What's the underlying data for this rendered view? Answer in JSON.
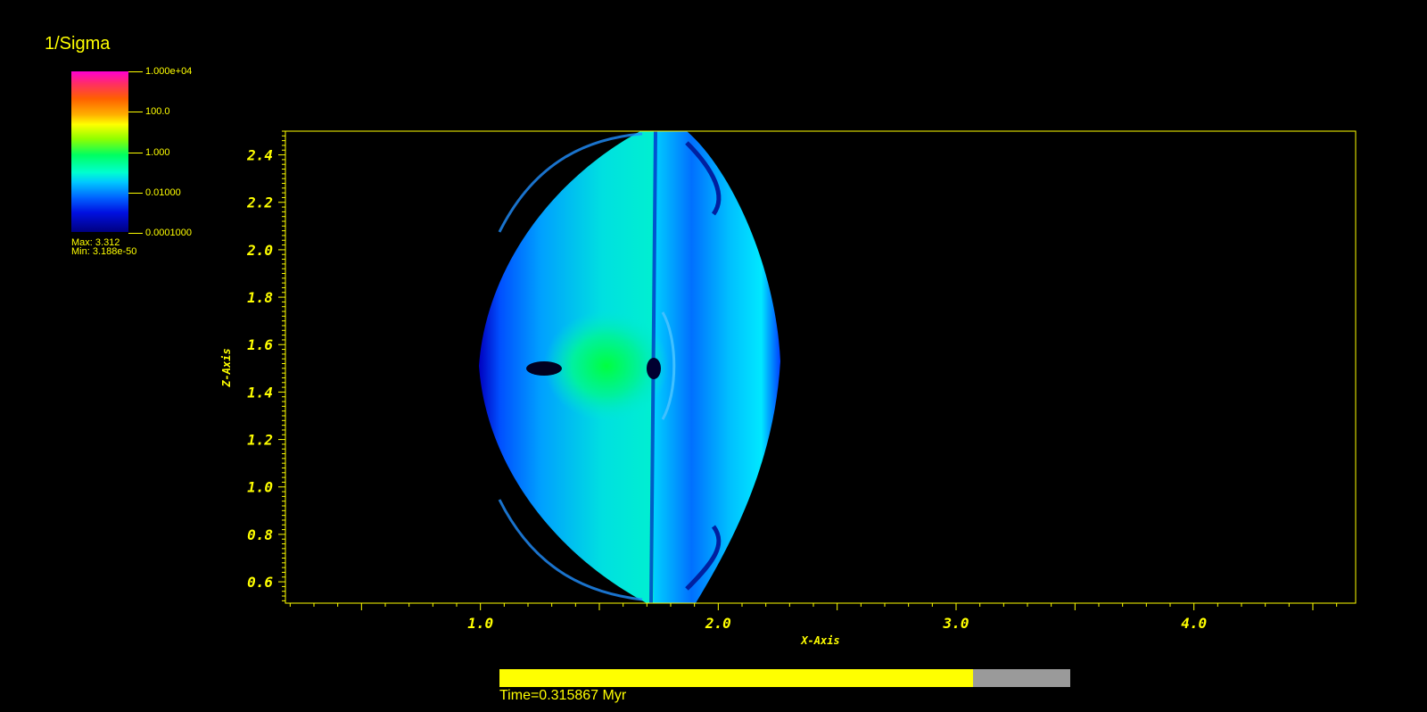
{
  "chart_data": {
    "type": "heatmap",
    "title": "1/Sigma",
    "xlabel": "X-Axis",
    "ylabel": "Z-Axis",
    "xlim": [
      0.18,
      4.68
    ],
    "ylim": [
      0.51,
      2.5
    ],
    "x_ticks": [
      "1.0",
      "2.0",
      "3.0",
      "4.0"
    ],
    "y_ticks": [
      "0.6",
      "0.8",
      "1.0",
      "1.2",
      "1.4",
      "1.6",
      "1.8",
      "2.0",
      "2.2",
      "2.4"
    ],
    "colorbar": {
      "scale": "log",
      "ticks": [
        "1.000e+04",
        "100.0",
        "1.000",
        "0.01000",
        "0.0001000"
      ],
      "max_label": "Max:  3.312",
      "min_label": "Min:  3.188e-50"
    },
    "colors": {
      "foreground": "#ffff00",
      "background": "#000000"
    }
  },
  "time_progress": {
    "label": "Time=0.315867 Myr",
    "fraction": 0.83
  }
}
